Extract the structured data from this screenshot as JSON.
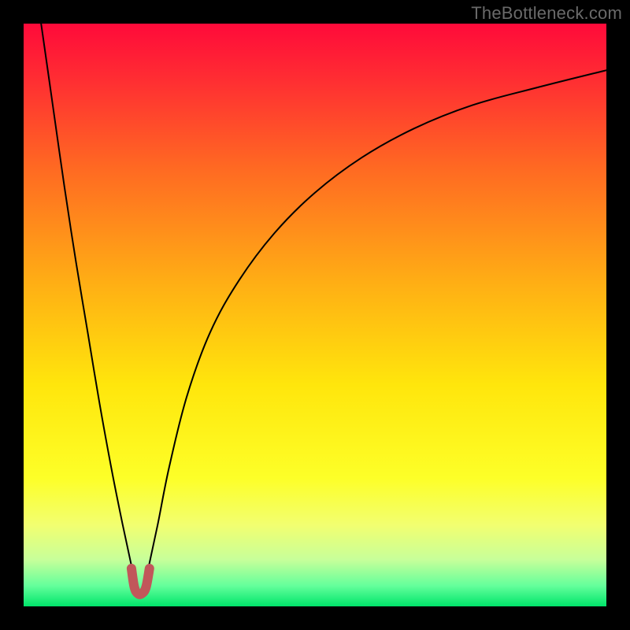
{
  "watermark": "TheBottleneck.com",
  "chart_data": {
    "type": "line",
    "title": "",
    "xlabel": "",
    "ylabel": "",
    "xlim": [
      0,
      100
    ],
    "ylim": [
      0,
      100
    ],
    "grid": false,
    "legend": false,
    "background_gradient_stops": [
      {
        "pos": 0.0,
        "color": "#ff0a3a"
      },
      {
        "pos": 0.1,
        "color": "#ff2f32"
      },
      {
        "pos": 0.25,
        "color": "#ff6a22"
      },
      {
        "pos": 0.45,
        "color": "#ffb014"
      },
      {
        "pos": 0.62,
        "color": "#ffe60c"
      },
      {
        "pos": 0.78,
        "color": "#fdff28"
      },
      {
        "pos": 0.86,
        "color": "#f2ff70"
      },
      {
        "pos": 0.92,
        "color": "#c7ff9a"
      },
      {
        "pos": 0.965,
        "color": "#63ff9b"
      },
      {
        "pos": 1.0,
        "color": "#00e46a"
      }
    ],
    "series": [
      {
        "name": "bottleneck-curve",
        "color": "#000000",
        "x": [
          3,
          5,
          7,
          9,
          11,
          13,
          15,
          17,
          18.5,
          19.5,
          20.5,
          21.5,
          23,
          25,
          28,
          32,
          37,
          43,
          50,
          58,
          67,
          77,
          88,
          100
        ],
        "y": [
          100,
          86,
          72,
          59,
          47,
          35,
          24,
          14,
          7,
          3,
          3,
          7,
          14,
          24,
          36,
          47,
          56,
          64,
          71,
          77,
          82,
          86,
          89,
          92
        ]
      },
      {
        "name": "optimal-marker",
        "color": "#c1575a",
        "stroke_width": 12,
        "x": [
          18.5,
          19.0,
          19.6,
          20.3,
          21.0,
          21.6
        ],
        "y": [
          6.5,
          3.3,
          2.2,
          2.2,
          3.3,
          6.5
        ]
      }
    ],
    "annotations": []
  }
}
